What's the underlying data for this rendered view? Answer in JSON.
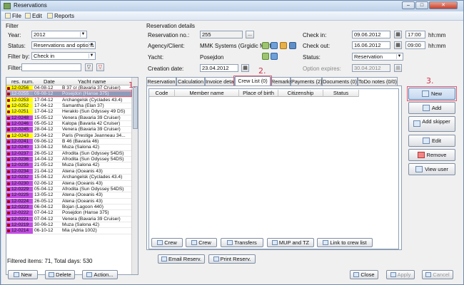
{
  "window": {
    "title": "Reservations",
    "controls": [
      "–",
      "□",
      "✕"
    ]
  },
  "menu": [
    {
      "label": "File",
      "icon": "file-icon"
    },
    {
      "label": "Edit",
      "icon": "edit-icon"
    },
    {
      "label": "Reports",
      "icon": "reports-icon"
    }
  ],
  "filter": {
    "group_label": "Filter",
    "year_label": "Year:",
    "year_value": "2012",
    "status_label": "Status:",
    "status_value": "Reservations and options",
    "filterby_label": "Filter by:",
    "filterby_value": "Check in",
    "filter_label": "Filter:",
    "filter_value": ""
  },
  "list": {
    "headers": [
      "res. num.",
      "Date",
      "Yacht name"
    ],
    "rows": [
      {
        "num": "12-0256",
        "date": "04-08-12",
        "yacht": "B 37 cr (Bavaria 37 Cruiser)",
        "color": "#ffff00"
      },
      {
        "num": "12-0255",
        "date": "09-08-12",
        "yacht": "Posejdon (Hanse 375)",
        "color": "#9aa6c4",
        "selected": true
      },
      {
        "num": "12-0253",
        "date": "17-04-12",
        "yacht": "Archangelsk (Cyclades 43.4)",
        "color": "#ffff00"
      },
      {
        "num": "12-0252",
        "date": "17-04-12",
        "yacht": "Samantha (Elan 37)",
        "color": "#ffff00"
      },
      {
        "num": "12-0251",
        "date": "17-04-12",
        "yacht": "Heraklo (Sun Odyssey 49 DS)",
        "color": "#ffff00"
      },
      {
        "num": "12-0248",
        "date": "15-05-12",
        "yacht": "Venera (Bavaria 39 Cruiser)",
        "color": "#c44ce6"
      },
      {
        "num": "12-0246",
        "date": "05-05-12",
        "yacht": "Kalopa (Bavaria 42 Cruiser)",
        "color": "#c44ce6"
      },
      {
        "num": "12-0245",
        "date": "28-04-12",
        "yacht": "Venera (Bavaria 39 Cruiser)",
        "color": "#c44ce6"
      },
      {
        "num": "12-0243",
        "date": "23-04-12",
        "yacht": "Paris (Prestige Jeanneau 34...",
        "color": "#ffff00"
      },
      {
        "num": "12-0241",
        "date": "09-06-12",
        "yacht": "B 46 (Bavaria 46)",
        "color": "#c44ce6"
      },
      {
        "num": "12-0240",
        "date": "13-04-12",
        "yacht": "Muza (Salona 42)",
        "color": "#c44ce6"
      },
      {
        "num": "12-0237",
        "date": "26-05-12",
        "yacht": "Afrodita (Sun Odyssey 54DS)",
        "color": "#c44ce6"
      },
      {
        "num": "12-0236",
        "date": "14-04-12",
        "yacht": "Afrodita (Sun Odyssey 54DS)",
        "color": "#c44ce6"
      },
      {
        "num": "12-0235",
        "date": "21-05-12",
        "yacht": "Muza (Salona 42)",
        "color": "#c44ce6"
      },
      {
        "num": "12-0234",
        "date": "21-04-12",
        "yacht": "Atena (Oceanis 43)",
        "color": "#c44ce6"
      },
      {
        "num": "12-0232",
        "date": "15-04-12",
        "yacht": "Archangelsk (Cyclades 43.4)",
        "color": "#c44ce6"
      },
      {
        "num": "12-0230",
        "date": "02-06-12",
        "yacht": "Atena (Oceanis 43)",
        "color": "#c44ce6"
      },
      {
        "num": "12-0229",
        "date": "05-04-12",
        "yacht": "Afrodita (Sun Odyssey 54DS)",
        "color": "#c44ce6"
      },
      {
        "num": "12-0225",
        "date": "13-05-12",
        "yacht": "Atena (Oceanis 43)",
        "color": "#c44ce6"
      },
      {
        "num": "12-0224",
        "date": "26-05-12",
        "yacht": "Atena (Oceanis 43)",
        "color": "#c44ce6"
      },
      {
        "num": "12-0223",
        "date": "06-04-12",
        "yacht": "Bojan (Lagoon 440)",
        "color": "#c44ce6"
      },
      {
        "num": "12-0222",
        "date": "07-04-12",
        "yacht": "Posejdon (Hanse 375)",
        "color": "#c44ce6"
      },
      {
        "num": "12-0221",
        "date": "07-04-12",
        "yacht": "Venera (Bavaria 39 Cruiser)",
        "color": "#c44ce6"
      },
      {
        "num": "12-0219",
        "date": "30-06-12",
        "yacht": "Muza (Salona 42)",
        "color": "#c44ce6"
      },
      {
        "num": "12-0214",
        "date": "06-10-12",
        "yacht": "Mia (Adria 1002)",
        "color": "#c44ce6"
      }
    ],
    "footer": "Filtered items: 71, Total days: 530"
  },
  "details": {
    "group_label": "Reservation details",
    "resno_label": "Reservation no.:",
    "resno_value": "255",
    "resno_btn": "...",
    "agency_label": "Agency/Client:",
    "agency_value": "MMK Systems (Grgidic Marko)",
    "yacht_label": "Yacht:",
    "yacht_value": "Posejdon",
    "creation_label": "Creation date:",
    "creation_value": "23.04.2012",
    "checkin_label": "Check in:",
    "checkin_date": "09.06.2012",
    "checkin_time": "17:00",
    "checkin_fmt": "hh:mm",
    "checkout_label": "Check out:",
    "checkout_date": "16.06.2012",
    "checkout_time": "09:00",
    "checkout_fmt": "hh:mm",
    "status_label": "Status:",
    "status_value": "Reservation",
    "option_label": "Option expires:",
    "option_value": "30.04.2012"
  },
  "tabs": [
    "Reservation",
    "Calculation",
    "Invoice detail",
    "Crew List (0)",
    "Remarks",
    "Payments (2)",
    "Documents (0)",
    "ToDo notes (0/0)"
  ],
  "crew_grid": {
    "headers": [
      "Code",
      "Member name",
      "Place of birth",
      "Citizenship",
      "Status"
    ]
  },
  "side_buttons": [
    "New",
    "Add",
    "Add skipper",
    "Edit",
    "Remove",
    "View user"
  ],
  "bottom_tab_buttons": [
    "Crew",
    "Crew",
    "Transfers",
    "MUP and TZ",
    "Link to crew list"
  ],
  "print_buttons": [
    "Email Reserv.",
    "Print Reserv."
  ],
  "footer_buttons": {
    "new": "New",
    "delete": "Delete",
    "action": "Action...",
    "close": "Close",
    "apply": "Apply",
    "cancel": "Cancel"
  },
  "annotations": [
    "1.",
    "2.",
    "3."
  ],
  "colors": {
    "annotation": "#e05a74",
    "yellow": "#ffff00",
    "purple": "#c44ce6"
  }
}
